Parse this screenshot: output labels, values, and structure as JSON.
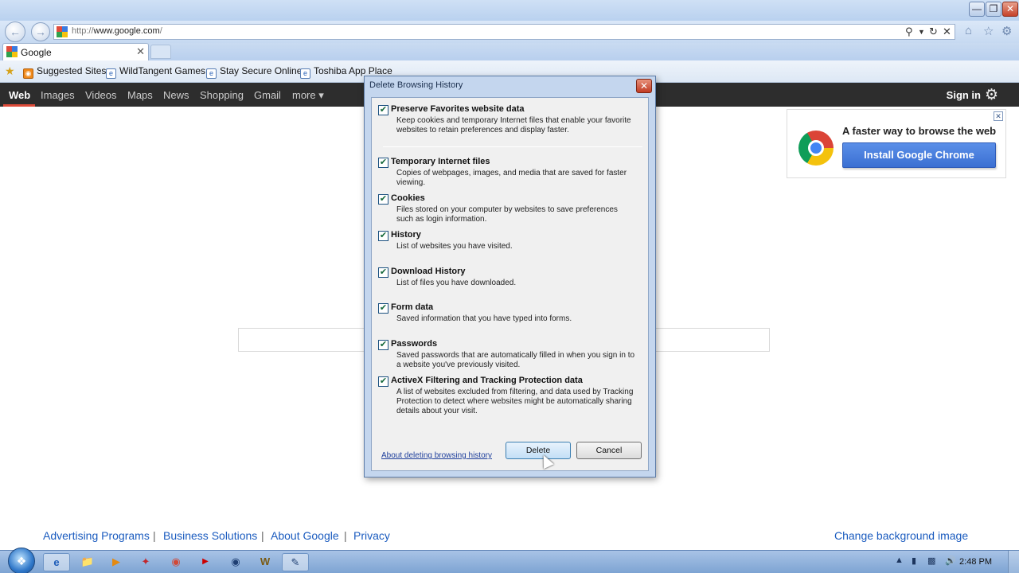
{
  "browser": {
    "address_url_prefix": "http://",
    "address_url_host": "www.google.com",
    "address_url_suffix": "/",
    "tab_label": "Google",
    "favorites": [
      {
        "label": "Suggested Sites",
        "icon": "suggested-sites-icon"
      },
      {
        "label": "WildTangent Games",
        "icon": "ie-page-icon"
      },
      {
        "label": "Stay Secure Online",
        "icon": "ie-page-icon"
      },
      {
        "label": "Toshiba App Place",
        "icon": "ie-page-icon"
      }
    ]
  },
  "google": {
    "nav": [
      "Web",
      "Images",
      "Videos",
      "Maps",
      "News",
      "Shopping",
      "Gmail",
      "more ▾"
    ],
    "sign_in": "Sign in",
    "promo_text": "A faster way to browse the web",
    "promo_button": "Install Google Chrome",
    "footer_left": [
      "Advertising Programs",
      "Business Solutions",
      "About Google",
      "Privacy"
    ],
    "footer_sep": "|",
    "footer_right": "Change background image"
  },
  "dialog": {
    "title": "Delete Browsing History",
    "options": [
      {
        "title": "Preserve Favorites website data",
        "desc": "Keep cookies and temporary Internet files that enable your favorite websites to retain preferences and display faster.",
        "checked": true
      },
      {
        "title": "Temporary Internet files",
        "desc": "Copies of webpages, images, and media that are saved for faster viewing.",
        "checked": true
      },
      {
        "title": "Cookies",
        "desc": "Files stored on your computer by websites to save preferences such as login information.",
        "checked": true
      },
      {
        "title": "History",
        "desc": "List of websites you have visited.",
        "checked": true
      },
      {
        "title": "Download History",
        "desc": "List of files you have downloaded.",
        "checked": true
      },
      {
        "title": "Form data",
        "desc": "Saved information that you have typed into forms.",
        "checked": true
      },
      {
        "title": "Passwords",
        "desc": "Saved passwords that are automatically filled in when you sign in to a website you've previously visited.",
        "checked": true
      },
      {
        "title": "ActiveX Filtering and Tracking Protection data",
        "desc": "A list of websites excluded from filtering, and data used by Tracking Protection to detect where websites might be automatically sharing details about your visit.",
        "checked": true
      }
    ],
    "about_link": "About deleting browsing history",
    "delete_button": "Delete",
    "cancel_button": "Cancel"
  },
  "taskbar": {
    "clock": "2:48 PM"
  },
  "colors": {
    "google_bar": "#2d2d2d",
    "link_blue": "#1a5bbf",
    "web_underline": "#dd4b39"
  }
}
